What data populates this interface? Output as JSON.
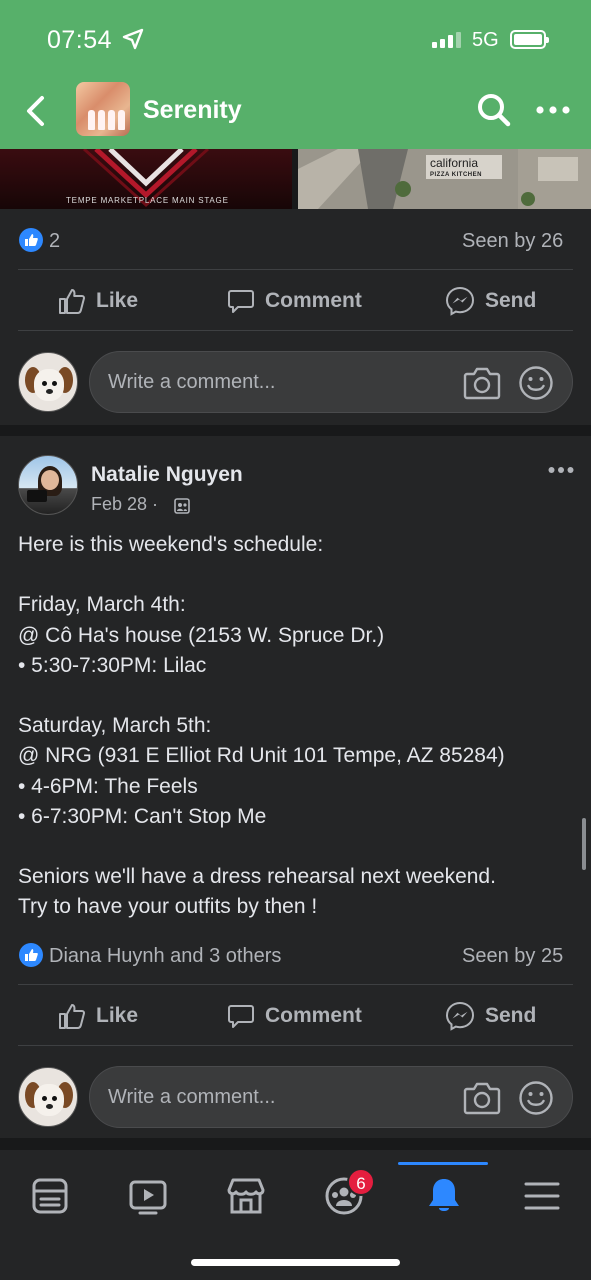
{
  "status_bar": {
    "time": "07:54",
    "network": "5G"
  },
  "header": {
    "group_name": "Serenity"
  },
  "media": {
    "left_caption": "TEMPE MARKETPLACE MAIN STAGE",
    "right_sign_line1": "california",
    "right_sign_line2": "PIZZA KITCHEN"
  },
  "post1": {
    "reaction_count": "2",
    "seen_by": "Seen by 26"
  },
  "actions": {
    "like": "Like",
    "comment": "Comment",
    "send": "Send"
  },
  "comment_placeholder": "Write a comment...",
  "post2": {
    "author": "Natalie Nguyen",
    "date": "Feb 28 ·",
    "body_lines": [
      "Here is this weekend's schedule:",
      "",
      "Friday, March 4th:",
      "@ Cô Ha's house (2153 W. Spruce Dr.)",
      "• 5:30-7:30PM: Lilac",
      "",
      "Saturday, March 5th:",
      "@ NRG (931 E Elliot Rd Unit 101 Tempe, AZ  85284)",
      "• 4-6PM: The Feels",
      "• 6-7:30PM: Can't Stop Me",
      "",
      "Seniors we'll have a dress rehearsal next weekend.",
      "Try to have your outfits by then !"
    ],
    "reactions": "Diana Huynh and 3 others",
    "seen_by": "Seen by 25"
  },
  "bottom_nav": {
    "items": [
      "feed-icon",
      "watch-icon",
      "marketplace-icon",
      "groups-icon",
      "notifications-icon",
      "menu-icon"
    ],
    "groups_badge": "6",
    "active": "notifications-icon"
  },
  "colors": {
    "header_green": "#57b06a",
    "accent_blue": "#2d88ff",
    "panel": "#242526",
    "background": "#18191a",
    "badge_red": "#e41e3f"
  }
}
